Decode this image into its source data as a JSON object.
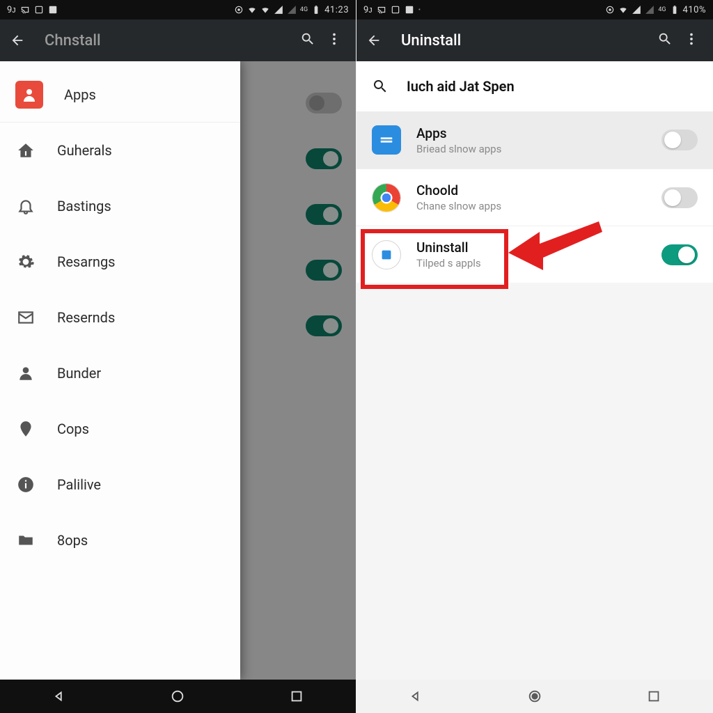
{
  "left": {
    "status": {
      "time": "41:23"
    },
    "appbar": {
      "title": "Chnstall"
    },
    "drawer": {
      "items": [
        {
          "label": "Apps",
          "icon": "avatar"
        },
        {
          "label": "Guherals",
          "icon": "home"
        },
        {
          "label": "Bastings",
          "icon": "bell"
        },
        {
          "label": "Resarngs",
          "icon": "gear"
        },
        {
          "label": "Resernds",
          "icon": "mail"
        },
        {
          "label": "Bunder",
          "icon": "person"
        },
        {
          "label": "Cops",
          "icon": "pin"
        },
        {
          "label": "Palilive",
          "icon": "info"
        },
        {
          "label": "8ops",
          "icon": "folder"
        }
      ]
    },
    "bg_toggles": [
      "off",
      "on",
      "on",
      "on",
      "on"
    ]
  },
  "right": {
    "status": {
      "time": "410%"
    },
    "appbar": {
      "title": "Uninstall"
    },
    "search_text": "Iuch aid Jat Spen",
    "apps": [
      {
        "title": "Apps",
        "sub": "Briead slnow apps",
        "icon": "blue",
        "toggle": "off",
        "shade": true
      },
      {
        "title": "Choold",
        "sub": "Chane slnow apps",
        "icon": "chrome",
        "toggle": "off",
        "shade": false
      },
      {
        "title": "Uninstall",
        "sub": "Tilped s appls",
        "icon": "outline",
        "toggle": "on",
        "shade": false
      }
    ]
  }
}
